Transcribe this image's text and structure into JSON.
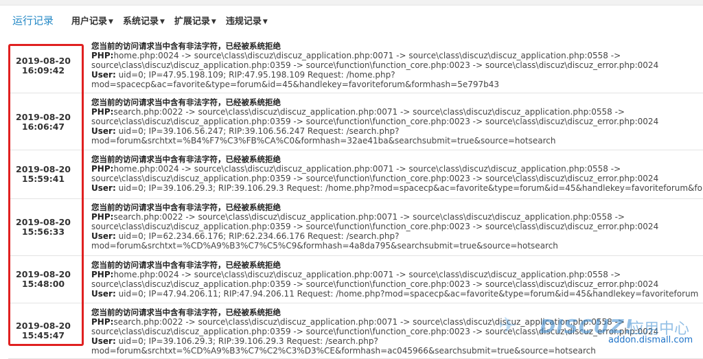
{
  "tabs": [
    {
      "label": "运行记录",
      "active": true
    },
    {
      "label": "用户记录",
      "active": false
    },
    {
      "label": "系统记录",
      "active": false
    },
    {
      "label": "扩展记录",
      "active": false
    },
    {
      "label": "违规记录",
      "active": false
    }
  ],
  "tab_caret": "▼",
  "highlight_color": "#e02020",
  "accent_color": "#2589c6",
  "records": [
    {
      "date": "2019-08-20",
      "time": "16:09:42",
      "title": "您当前的访问请求当中含有非法字符，已经被系统拒绝",
      "php_label": "PHP:",
      "php_1": "home.php:0024 -> source\\class\\discuz\\discuz_application.php:0071 -> source\\class\\discuz\\discuz_application.php:0558 ->",
      "php_2": "source\\class\\discuz\\discuz_application.php:0359 -> source\\function\\function_core.php:0023 -> source\\class\\discuz\\discuz_error.php:0024",
      "user_label": "User:",
      "user_1": " uid=0; IP=47.95.198.109; RIP:47.95.198.109 Request: /home.php?",
      "user_2": "mod=spacecp&ac=favorite&type=forum&id=45&handlekey=favoriteforum&formhash=5e797b43"
    },
    {
      "date": "2019-08-20",
      "time": "16:06:47",
      "title": "您当前的访问请求当中含有非法字符，已经被系统拒绝",
      "php_label": "PHP:",
      "php_1": "search.php:0022 -> source\\class\\discuz\\discuz_application.php:0071 -> source\\class\\discuz\\discuz_application.php:0558 ->",
      "php_2": "source\\class\\discuz\\discuz_application.php:0359 -> source\\function\\function_core.php:0023 -> source\\class\\discuz\\discuz_error.php:0024",
      "user_label": "User:",
      "user_1": " uid=0; IP=39.106.56.247; RIP:39.106.56.247 Request: /search.php?",
      "user_2": "mod=forum&srchtxt=%B4%F7%C3%FB%CA%C0&formhash=32ae41ba&searchsubmit=true&source=hotsearch"
    },
    {
      "date": "2019-08-20",
      "time": "15:59:41",
      "title": "您当前的访问请求当中含有非法字符，已经被系统拒绝",
      "php_label": "PHP:",
      "php_1": "home.php:0024 -> source\\class\\discuz\\discuz_application.php:0071 -> source\\class\\discuz\\discuz_application.php:0558 ->",
      "php_2": "source\\class\\discuz\\discuz_application.php:0359 -> source\\function\\function_core.php:0023 -> source\\class\\discuz\\discuz_error.php:0024",
      "user_label": "User:",
      "user_1": " uid=0; IP=39.106.29.3; RIP:39.106.29.3 Request: /home.php?mod=spacecp&ac=favorite&type=forum&id=45&handlekey=favoriteforum&fo",
      "user_2": ""
    },
    {
      "date": "2019-08-20",
      "time": "15:56:33",
      "title": "您当前的访问请求当中含有非法字符，已经被系统拒绝",
      "php_label": "PHP:",
      "php_1": "search.php:0022 -> source\\class\\discuz\\discuz_application.php:0071 -> source\\class\\discuz\\discuz_application.php:0558 ->",
      "php_2": "source\\class\\discuz\\discuz_application.php:0359 -> source\\function\\function_core.php:0023 -> source\\class\\discuz\\discuz_error.php:0024",
      "user_label": "User:",
      "user_1": " uid=0; IP=62.234.66.176; RIP:62.234.66.176 Request: /search.php?",
      "user_2": "mod=forum&srchtxt=%CD%A9%B3%C7%C5%C9&formhash=4a8da795&searchsubmit=true&source=hotsearch"
    },
    {
      "date": "2019-08-20",
      "time": "15:48:00",
      "title": "您当前的访问请求当中含有非法字符，已经被系统拒绝",
      "php_label": "PHP:",
      "php_1": "home.php:0024 -> source\\class\\discuz\\discuz_application.php:0071 -> source\\class\\discuz\\discuz_application.php:0558 ->",
      "php_2": "source\\class\\discuz\\discuz_application.php:0359 -> source\\function\\function_core.php:0023 -> source\\class\\discuz\\discuz_error.php:0024",
      "user_label": "User:",
      "user_1": " uid=0; IP=47.94.206.11; RIP:47.94.206.11 Request: /home.php?mod=spacecp&ac=favorite&type=forum&id=45&handlekey=favoriteforum",
      "user_2": ""
    },
    {
      "date": "2019-08-20",
      "time": "15:45:47",
      "title": "您当前的访问请求当中含有非法字符，已经被系统拒绝",
      "php_label": "PHP:",
      "php_1": "search.php:0022 -> source\\class\\discuz\\discuz_application.php:0071 -> source\\class\\discuz\\discuz_application.php:0558 ->",
      "php_2": "source\\class\\discuz\\discuz_application.php:0359 -> source\\function\\function_core.php:0023 -> source\\class\\discuz\\discuz_error.php:0024",
      "user_label": "User:",
      "user_1": " uid=0; IP=39.106.29.3; RIP:39.106.29.3 Request: /search.php?",
      "user_2": "mod=forum&srchtxt=%CD%A9%B3%C7%C2%C3%D3%CE&formhash=ac045966&searchsubmit=true&source=hotsearch"
    }
  ],
  "watermark": {
    "brand": "DISCUZ!",
    "brand_cn": "应用中心",
    "url": "addon.dismall.com"
  }
}
